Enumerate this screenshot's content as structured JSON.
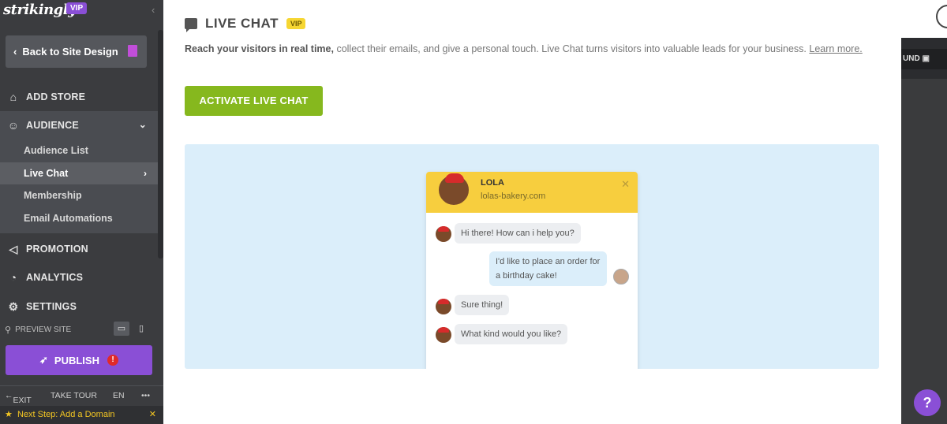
{
  "sidebar": {
    "logo": "strikingly",
    "vip": "VIP",
    "back_label": "Back to Site Design",
    "nav": {
      "add_store": "ADD STORE",
      "audience": "AUDIENCE",
      "promotion": "PROMOTION",
      "analytics": "ANALYTICS",
      "settings": "SETTINGS"
    },
    "audience_items": [
      "Audience List",
      "Live Chat",
      "Membership",
      "Email Automations"
    ],
    "preview_site": "PREVIEW SITE",
    "publish": "PUBLISH",
    "publish_alert": "!",
    "bottom": {
      "exit": "EXIT",
      "tour": "TAKE TOUR",
      "lang": "EN",
      "more": "•••"
    },
    "next_step": "Next Step: Add a Domain"
  },
  "main": {
    "title": "LIVE CHAT",
    "vip": "VIP",
    "desc_bold": "Reach your visitors in real time,",
    "desc_rest": " collect their emails, and give a personal touch. Live Chat turns visitors into valuable leads for your business. ",
    "learn_more": "Learn more.",
    "activate": "ACTIVATE LIVE CHAT",
    "chat": {
      "agent_name": "LOLA",
      "agent_site": "lolas-bakery.com",
      "messages": [
        "Hi there! How can i help you?",
        "I'd like to place an order for a birthday cake!",
        "Sure thing!",
        "What kind would you like?"
      ]
    }
  },
  "right_strip": {
    "bg_button": "UND"
  },
  "help": "?"
}
